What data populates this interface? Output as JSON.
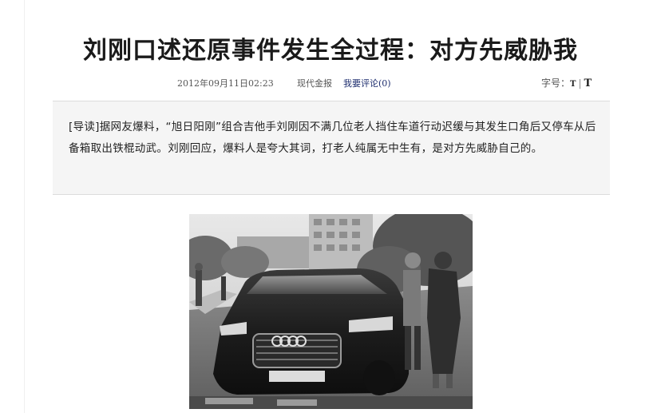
{
  "article": {
    "title": "刘刚口述还原事件发生全过程：对方先威胁我",
    "date": "2012年09月11日02:23",
    "source": "现代金报",
    "comment_label": "我要评论",
    "comment_count": "(0)",
    "fontsize_label": "字号：",
    "fontsize_small": "T",
    "fontsize_sep": "|",
    "fontsize_large": "T",
    "summary": "[导读]据网友爆料，“旭日阳刚”组合吉他手刘刚因不满几位老人挡住车道行动迟缓与其发生口角后又停车从后备箱取出铁棍动武。刘刚回应，爆料人是夸大其词，打老人纯属无中生有，是对方先威胁自己的。"
  },
  "photo": {
    "subject": "black sedan with people standing beside it",
    "tone": "grayscale"
  }
}
